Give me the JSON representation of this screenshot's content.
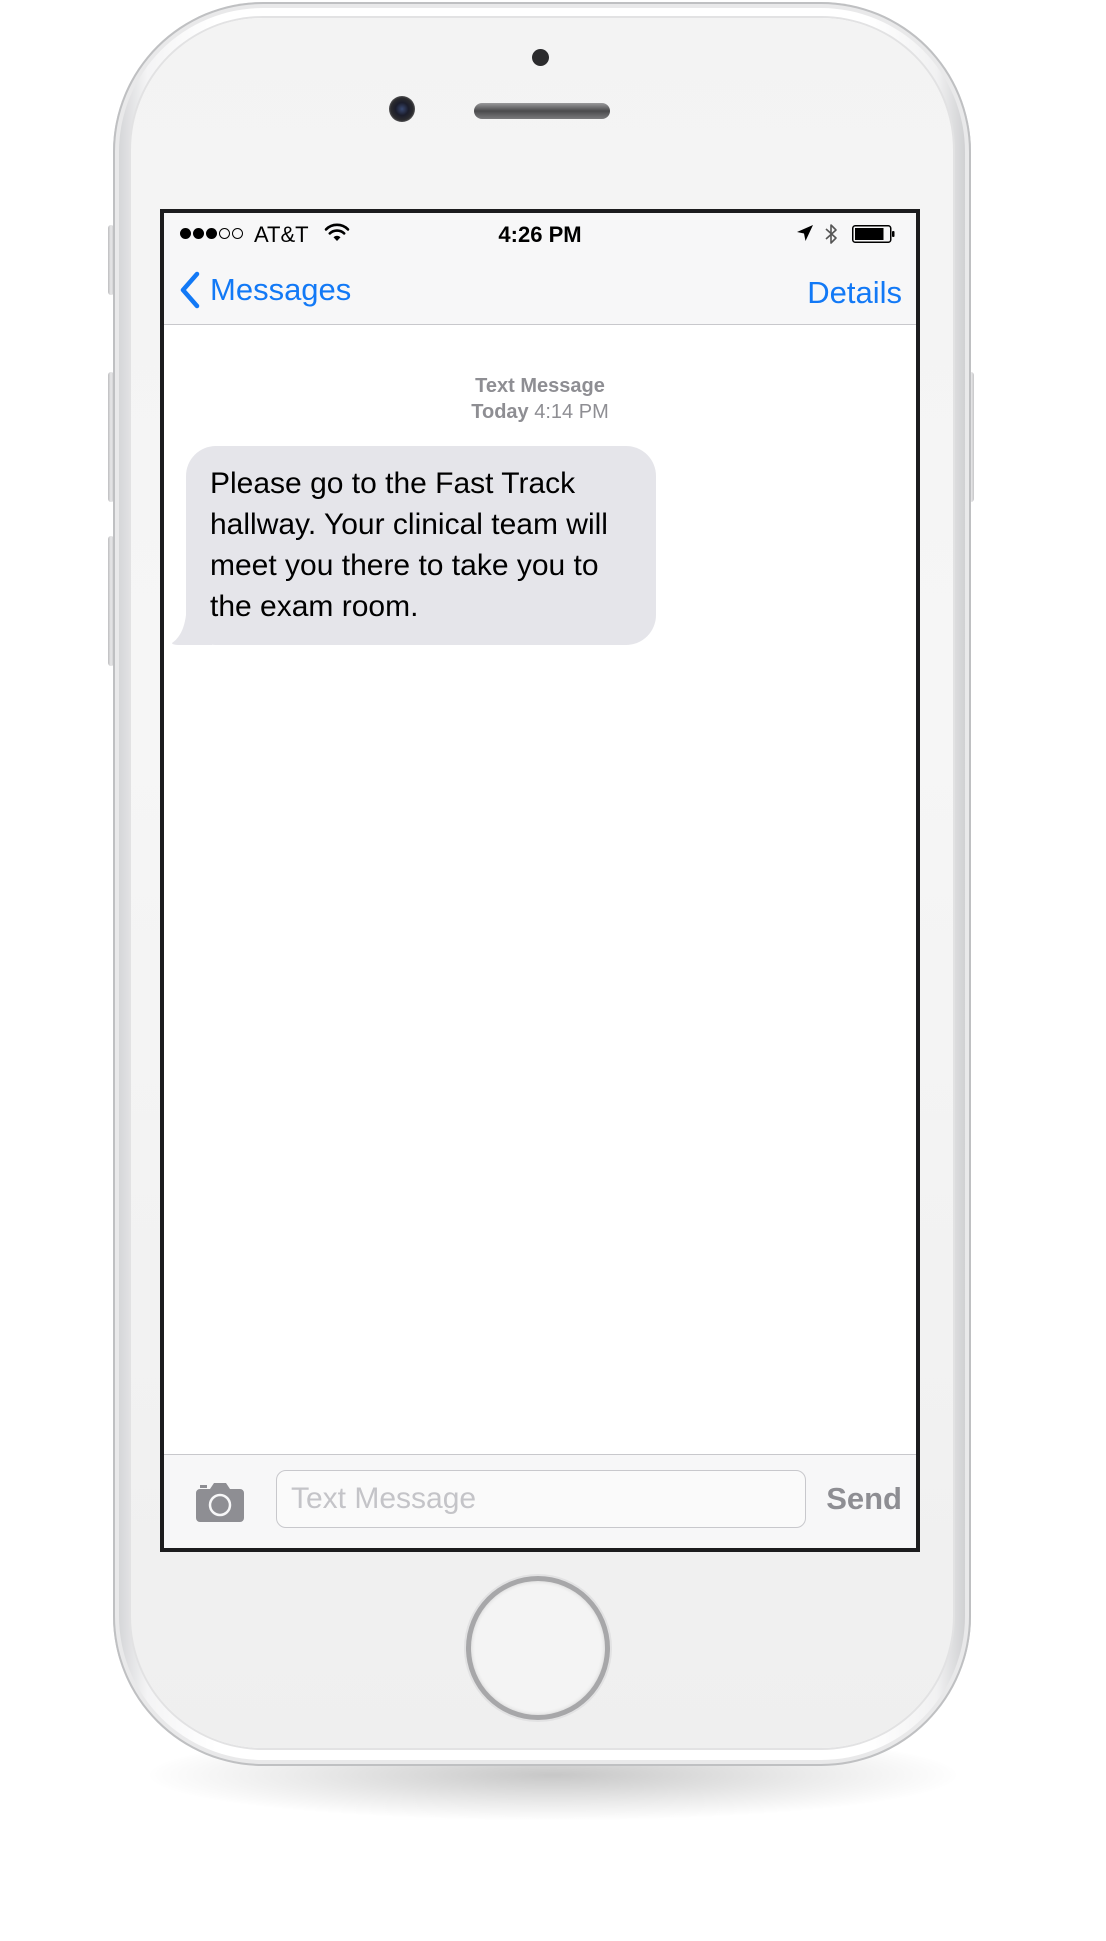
{
  "status_bar": {
    "signal_dots_filled": 3,
    "signal_dots_total": 5,
    "carrier": "AT&T",
    "time": "4:26 PM",
    "battery_level_percent": 85
  },
  "nav": {
    "back_label": "Messages",
    "details_label": "Details"
  },
  "conversation": {
    "meta_title": "Text Message",
    "meta_day": "Today",
    "meta_time": "4:14 PM",
    "messages": [
      {
        "direction": "incoming",
        "text": "Please go to the Fast Track hallway. Your clinical team will meet you there to take you to the exam room."
      }
    ]
  },
  "composer": {
    "placeholder": "Text Message",
    "value": "",
    "send_label": "Send"
  },
  "colors": {
    "accent": "#1279f6",
    "incoming_bubble": "#e5e5ea",
    "meta_gray": "#8e8e93"
  },
  "icons": {
    "back": "chevron-left-icon",
    "camera": "camera-icon",
    "wifi": "wifi-icon",
    "location": "location-arrow-icon",
    "bluetooth": "bluetooth-icon",
    "battery": "battery-icon"
  }
}
